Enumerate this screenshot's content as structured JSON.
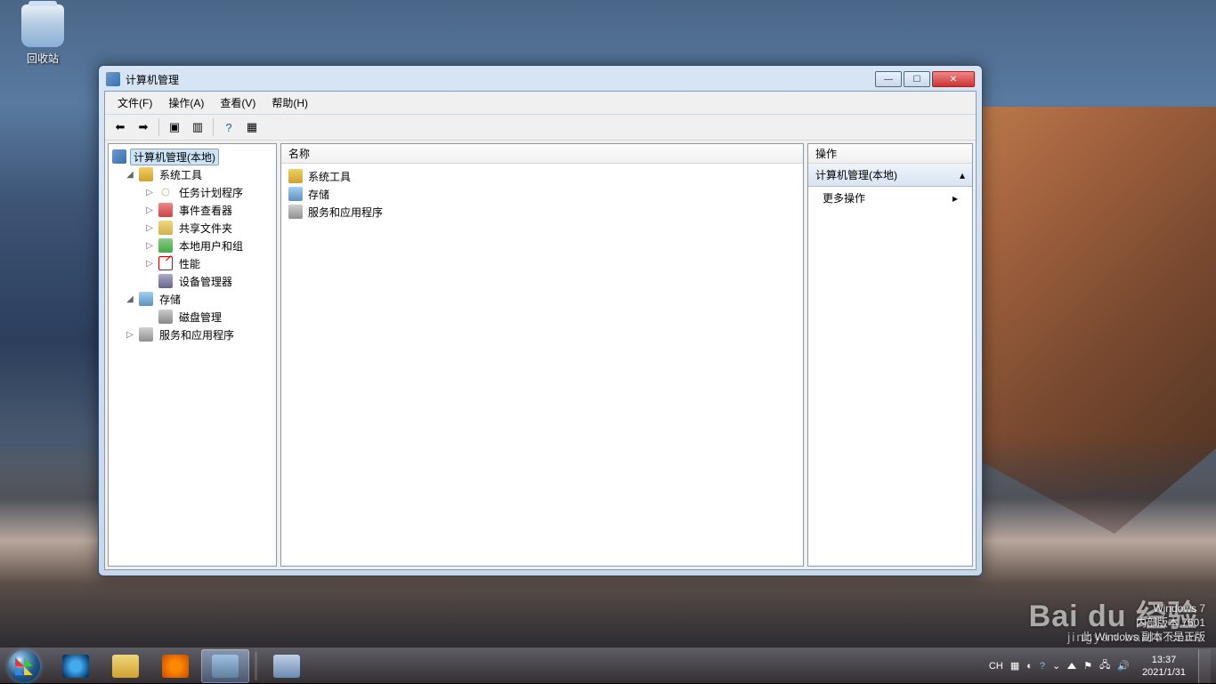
{
  "desktop": {
    "recycle_bin": "回收站"
  },
  "window": {
    "title": "计算机管理",
    "menu": {
      "file": "文件(F)",
      "action": "操作(A)",
      "view": "查看(V)",
      "help": "帮助(H)"
    },
    "tree": {
      "root": "计算机管理(本地)",
      "system_tools": "系统工具",
      "task_scheduler": "任务计划程序",
      "event_viewer": "事件查看器",
      "shared_folders": "共享文件夹",
      "local_users": "本地用户和组",
      "performance": "性能",
      "device_manager": "设备管理器",
      "storage": "存储",
      "disk_management": "磁盘管理",
      "services_apps": "服务和应用程序"
    },
    "list": {
      "header": "名称",
      "items": [
        "系统工具",
        "存储",
        "服务和应用程序"
      ]
    },
    "actions": {
      "header": "操作",
      "group": "计算机管理(本地)",
      "more": "更多操作"
    }
  },
  "taskbar": {
    "ime": "CH",
    "time": "13:37",
    "date": "2021/1/31"
  },
  "watermark": {
    "line1": "Windows 7",
    "line2": "内部版本 7601",
    "line3": "此 Windows 副本不是正版",
    "brand": "Bai du 经验",
    "brand_sub": "jingyan.baidu.com"
  }
}
